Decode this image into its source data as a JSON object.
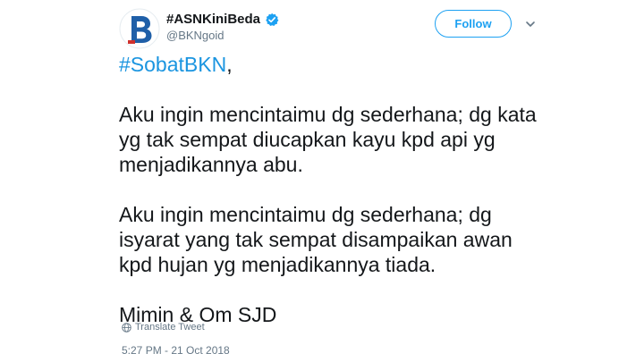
{
  "user": {
    "display_name": "#ASNKiniBeda",
    "handle": "@BKNgoid",
    "avatar_icon": "bkn-logo-icon",
    "verified_icon": "verified-badge-icon"
  },
  "actions": {
    "follow_label": "Follow",
    "menu_icon": "chevron-down-icon"
  },
  "tweet": {
    "hashtag": "#SobatBKN",
    "hashtag_suffix": ",",
    "paragraph1": "Aku ingin mencintaimu dg sederhana; dg kata yg tak sempat diucapkan kayu kpd api yg menjadikannya abu.",
    "paragraph2": "Aku ingin mencintaimu dg sederhana; dg isyarat yang tak sempat disampaikan awan kpd hujan yg menjadikannya tiada.",
    "signature": "Mimin & Om SJD"
  },
  "footer": {
    "translate_label": "Translate Tweet",
    "timestamp": "5:27 PM - 21 Oct 2018"
  },
  "colors": {
    "accent": "#1da1f2",
    "hashtag": "#1b95e0",
    "muted": "#657786",
    "text": "#14171a"
  }
}
